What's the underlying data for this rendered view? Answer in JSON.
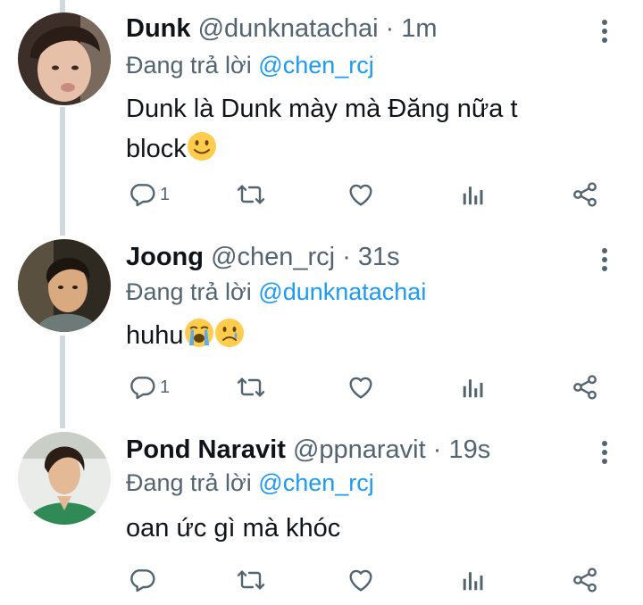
{
  "colors": {
    "accent": "#1d9bf0",
    "muted": "#536471",
    "text": "#0f1419",
    "thread": "#cfd9de"
  },
  "tweets": [
    {
      "name": "Dunk",
      "handle": "@dunknatachai",
      "time": "· 1m",
      "reply_prefix": "Đang trả lời",
      "reply_to": "@chen_rcj",
      "text_line1": "Dunk là Dunk mày mà Đăng nữa t",
      "text_line2": "block",
      "emojis": [
        "slightly-smiling-face"
      ],
      "reply_count": "1"
    },
    {
      "name": "Joong",
      "handle": "@chen_rcj",
      "time": "· 31s",
      "reply_prefix": "Đang trả lời",
      "reply_to": "@dunknatachai",
      "text_line1": "huhu",
      "emojis": [
        "loudly-crying-face",
        "crying-face"
      ],
      "reply_count": "1"
    },
    {
      "name": "Pond Naravit",
      "handle": "@ppnaravit",
      "time": "· 19s",
      "reply_prefix": "Đang trả lời",
      "reply_to": "@chen_rcj",
      "text_line1": "oan ức gì mà khóc",
      "emojis": [],
      "reply_count": ""
    }
  ],
  "icons": [
    "reply-icon",
    "retweet-icon",
    "like-icon",
    "views-icon",
    "share-icon",
    "more-icon"
  ]
}
